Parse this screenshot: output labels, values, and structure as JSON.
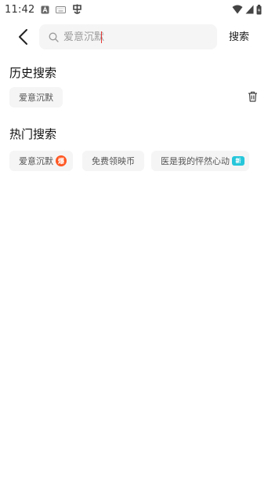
{
  "status_bar": {
    "time": "11:42",
    "left_icons": [
      "notification-a-icon",
      "keyboard-icon",
      "app-notification-icon"
    ],
    "right_icons": [
      "wifi-icon",
      "cellular-signal-icon",
      "battery-charging-icon"
    ]
  },
  "search": {
    "placeholder": "爱意沉默",
    "value": "",
    "submit_label": "搜索"
  },
  "history": {
    "title": "历史搜索",
    "items": [
      {
        "label": "爱意沉默"
      }
    ]
  },
  "hot": {
    "title": "热门搜索",
    "items": [
      {
        "label": "爱意沉默",
        "badge": "爆",
        "badge_color": "#ff5722"
      },
      {
        "label": "免费领映币"
      },
      {
        "label": "医是我的怦然心动",
        "badge": "新",
        "badge_color": "#26c6da"
      }
    ]
  },
  "colors": {
    "accent_caret": "#e53935",
    "chip_bg": "#f5f5f5"
  }
}
